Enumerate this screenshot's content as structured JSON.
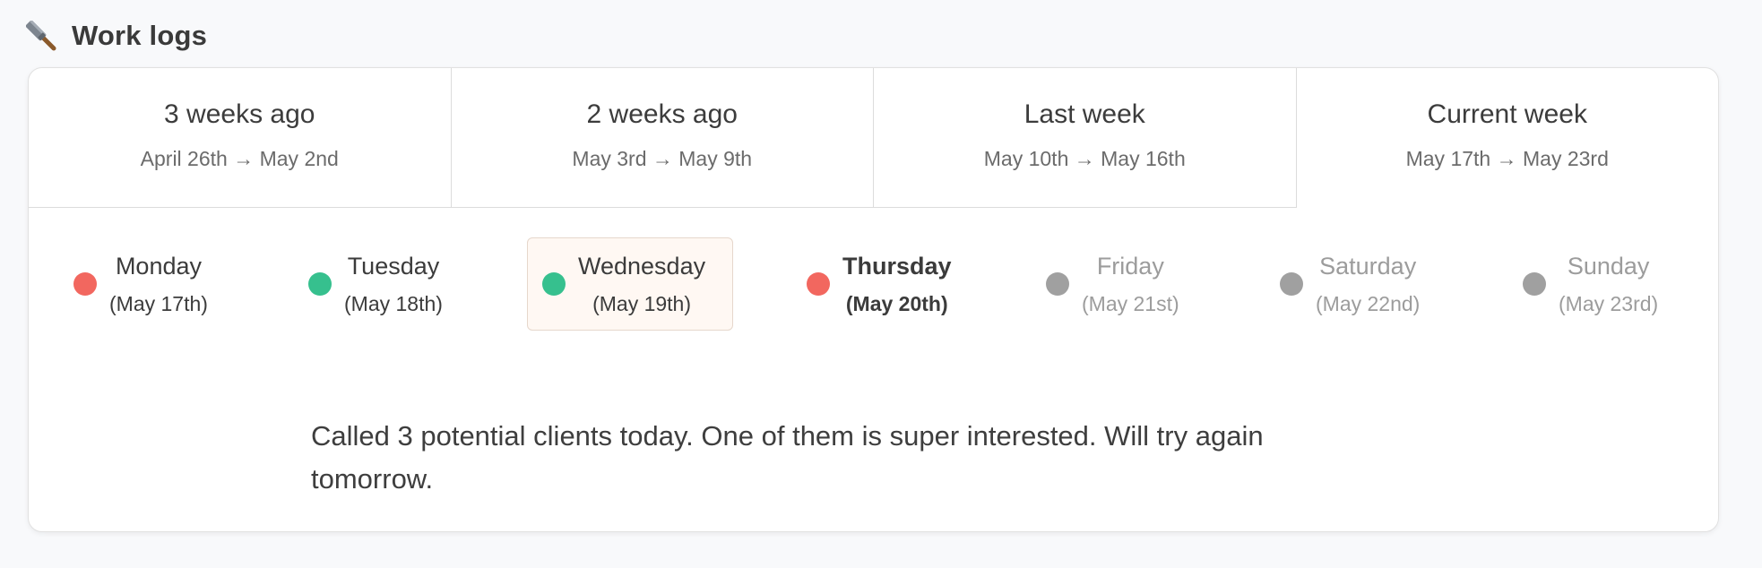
{
  "header": {
    "title": "Work logs",
    "icon": "hammer-icon"
  },
  "weeks": [
    {
      "title": "3 weeks ago",
      "range": "April 26th → May 2nd",
      "active": false
    },
    {
      "title": "2 weeks ago",
      "range": "May 3rd → May 9th",
      "active": false
    },
    {
      "title": "Last week",
      "range": "May 10th → May 16th",
      "active": false
    },
    {
      "title": "Current week",
      "range": "May 17th → May 23rd",
      "active": true
    }
  ],
  "days": [
    {
      "name": "Monday",
      "date": "(May 17th)",
      "status": "missed"
    },
    {
      "name": "Tuesday",
      "date": "(May 18th)",
      "status": "logged"
    },
    {
      "name": "Wednesday",
      "date": "(May 19th)",
      "status": "logged",
      "selected": true
    },
    {
      "name": "Thursday",
      "date": "(May 20th)",
      "status": "missed",
      "today": true
    },
    {
      "name": "Friday",
      "date": "(May 21st)",
      "status": "future"
    },
    {
      "name": "Saturday",
      "date": "(May 22nd)",
      "status": "future"
    },
    {
      "name": "Sunday",
      "date": "(May 23rd)",
      "status": "future"
    }
  ],
  "colors": {
    "missed": "#f2675f",
    "logged": "#36c08e",
    "future": "#a0a0a0"
  },
  "note": {
    "text": "Called 3 potential clients today. One of them is super interested. Will try again tomorrow."
  }
}
